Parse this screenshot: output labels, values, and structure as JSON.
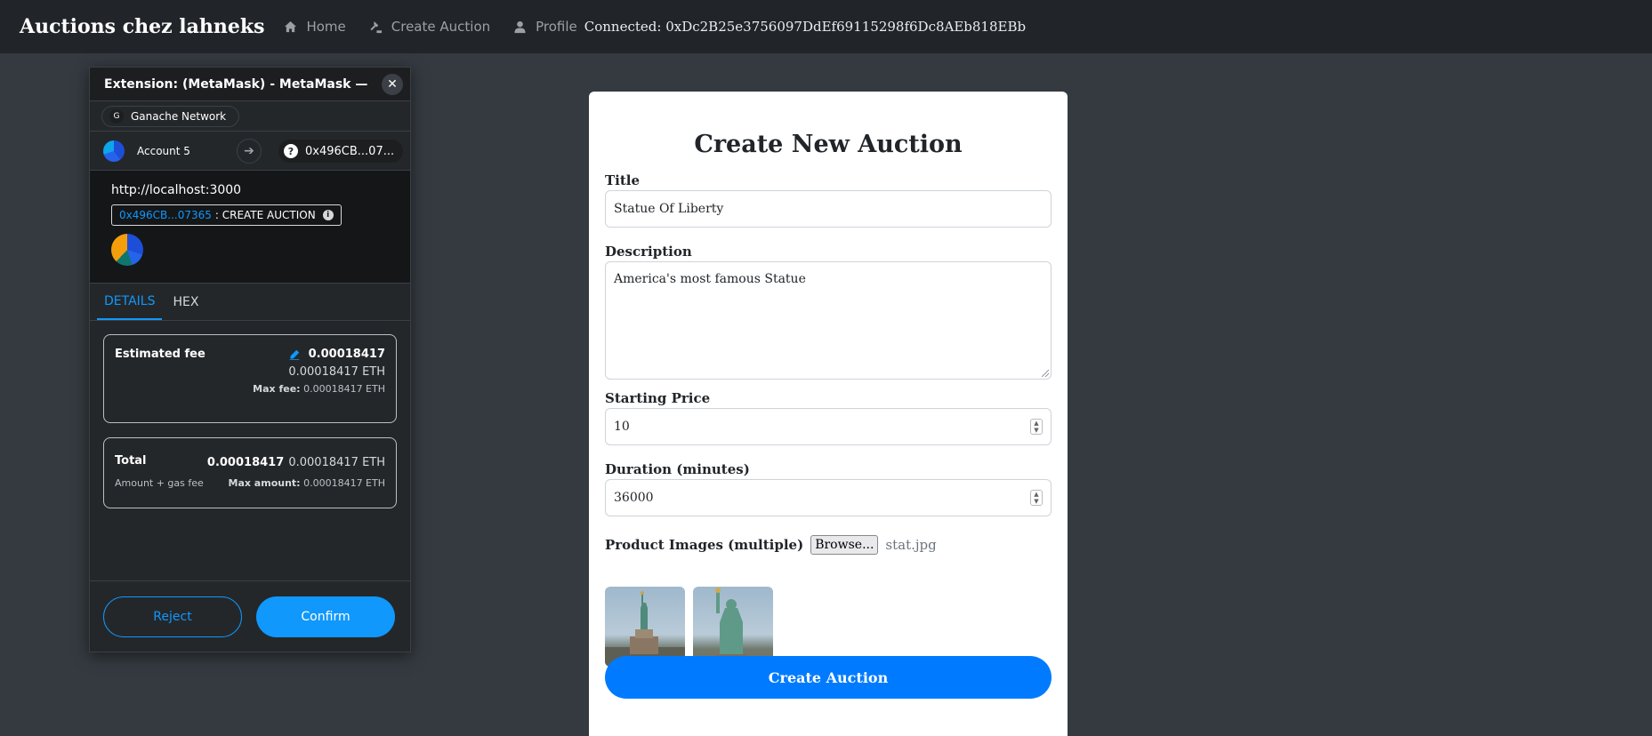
{
  "navbar": {
    "brand": "Auctions chez lahneks",
    "links": [
      {
        "label": "Home",
        "icon": "home-icon"
      },
      {
        "label": "Create Auction",
        "icon": "gavel-icon"
      },
      {
        "label": "Profile",
        "icon": "user-icon"
      }
    ],
    "connected": "Connected: 0xDc2B25e3756097DdEf69115298f6Dc8AEb818EBb"
  },
  "metamask": {
    "window_title": "Extension: (MetaMask) - MetaMask — M...",
    "network": "Ganache Network",
    "network_initial": "G",
    "account": "Account 5",
    "to_address": "0x496CB...07...",
    "origin": "http://localhost:3000",
    "contract": "0x496CB...07365",
    "method": ": CREATE AUCTION",
    "tabs": [
      "DETAILS",
      "HEX"
    ],
    "active_tab": "DETAILS",
    "estimated_fee": {
      "label": "Estimated fee",
      "value_bold": "0.00018417",
      "value_eth": "0.00018417 ETH",
      "max_fee_label": "Max fee:",
      "max_fee_value": "0.00018417 ETH"
    },
    "total": {
      "label": "Total",
      "value_bold": "0.00018417",
      "value_eth": "0.00018417 ETH",
      "sub_label": "Amount + gas fee",
      "max_amount_label": "Max amount:",
      "max_amount_value": "0.00018417 ETH"
    },
    "reject_label": "Reject",
    "confirm_label": "Confirm",
    "accent_color": "#1098fc"
  },
  "form": {
    "heading": "Create New Auction",
    "title_label": "Title",
    "title_value": "Statue Of Liberty",
    "description_label": "Description",
    "description_value": "America's most famous Statue",
    "starting_price_label": "Starting Price",
    "starting_price_value": "10",
    "duration_label": "Duration (minutes)",
    "duration_value": "36000",
    "images_label": "Product Images (multiple)",
    "browse_label": "Browse...",
    "file_name": "stat.jpg",
    "submit_label": "Create Auction",
    "button_color": "#007bff"
  }
}
